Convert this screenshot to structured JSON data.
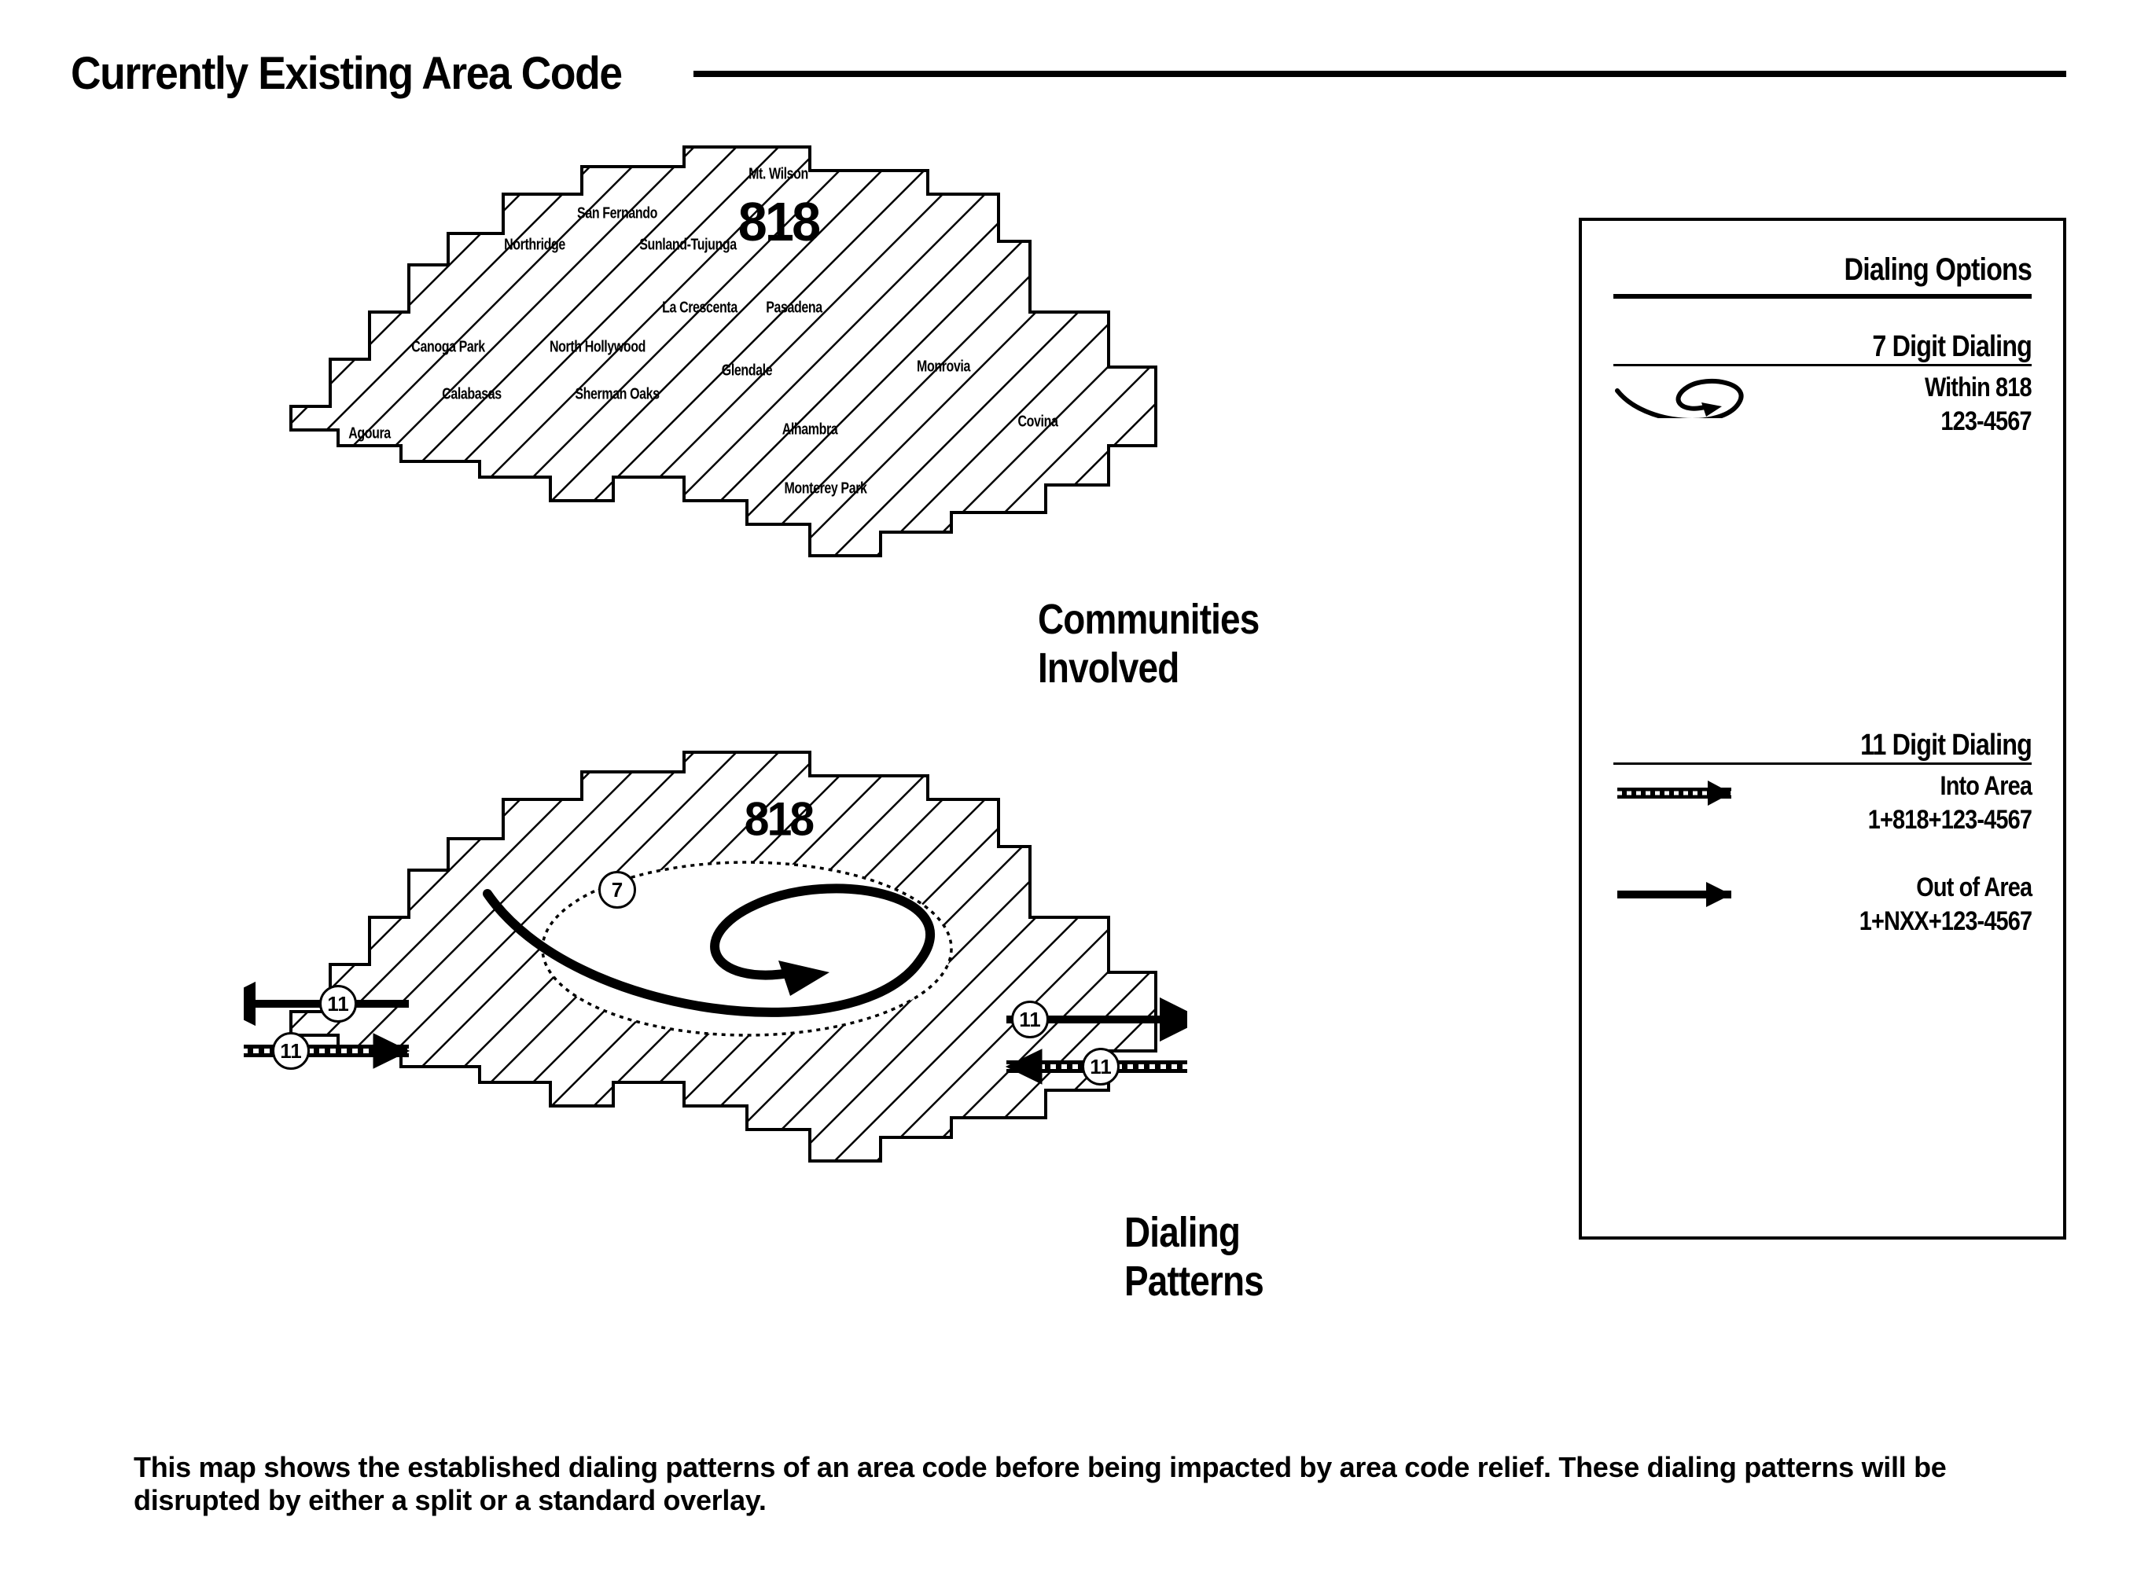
{
  "title": "Currently Existing Area Code",
  "maps": {
    "communities_caption": "Communities Involved",
    "dialing_caption": "Dialing Patterns",
    "area_code": "818",
    "communities": [
      "Mt. Wilson",
      "San Fernando",
      "Northridge",
      "Sunland-Tujunga",
      "La Crescenta",
      "Pasadena",
      "Canoga Park",
      "North Hollywood",
      "Glendale",
      "Monrovia",
      "Calabasas",
      "Sherman Oaks",
      "Alhambra",
      "Covina",
      "Agoura",
      "Monterey Park"
    ],
    "dialing_markers": {
      "seven": "7",
      "eleven": "11"
    }
  },
  "legend": {
    "heading": "Dialing Options",
    "item1": {
      "title": "7 Digit Dialing",
      "sub1": "Within 818",
      "sub2": "123-4567"
    },
    "item2": {
      "title": "11 Digit Dialing",
      "row1": {
        "label": "Into Area",
        "pattern": "1+818+123-4567"
      },
      "row2": {
        "label": "Out of Area",
        "pattern": "1+NXX+123-4567"
      }
    }
  },
  "footnote": "This map shows the established dialing patterns of an area code before being impacted by area code relief. These dialing patterns will be disrupted by either a split or a standard overlay."
}
